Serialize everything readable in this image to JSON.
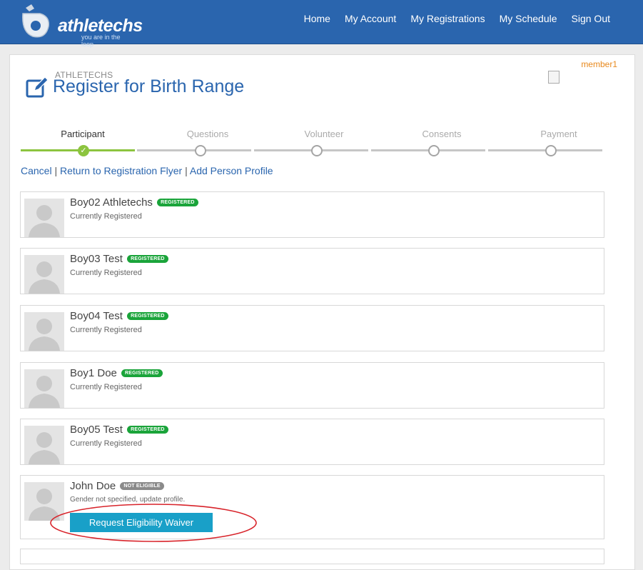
{
  "header": {
    "logo_text": "athletechs",
    "logo_tagline": "you are in the loop",
    "nav": [
      "Home",
      "My Account",
      "My Registrations",
      "My Schedule",
      "Sign Out"
    ]
  },
  "page": {
    "username": "member1",
    "org_name": "ATHLETECHS",
    "title": "Register for Birth Range"
  },
  "steps": [
    {
      "label": "Participant",
      "state": "done"
    },
    {
      "label": "Questions",
      "state": "pending"
    },
    {
      "label": "Volunteer",
      "state": "pending"
    },
    {
      "label": "Consents",
      "state": "pending"
    },
    {
      "label": "Payment",
      "state": "pending"
    }
  ],
  "actions": {
    "cancel": "Cancel",
    "return_flyer": "Return to Registration Flyer",
    "add_profile": "Add Person Profile",
    "separator": "|"
  },
  "participants": [
    {
      "name": "Boy02 Athletechs",
      "badge": "REGISTERED",
      "status": "Currently Registered"
    },
    {
      "name": "Boy03 Test",
      "badge": "REGISTERED",
      "status": "Currently Registered"
    },
    {
      "name": "Boy04 Test",
      "badge": "REGISTERED",
      "status": "Currently Registered"
    },
    {
      "name": "Boy1 Doe",
      "badge": "REGISTERED",
      "status": "Currently Registered"
    },
    {
      "name": "Boy05 Test",
      "badge": "REGISTERED",
      "status": "Currently Registered"
    },
    {
      "name": "John Doe",
      "badge": "NOT ELIGIBLE",
      "status": "Gender not specified, update profile.",
      "button": "Request Eligibility Waiver"
    }
  ],
  "colors": {
    "brand_blue": "#2a65ae",
    "step_active": "#8cc43f",
    "badge_registered": "#1aa43a",
    "badge_not_eligible": "#8a8a8a",
    "waiver_button": "#19a0c8",
    "annotation_red": "#d8232a",
    "username": "#e8891d"
  }
}
